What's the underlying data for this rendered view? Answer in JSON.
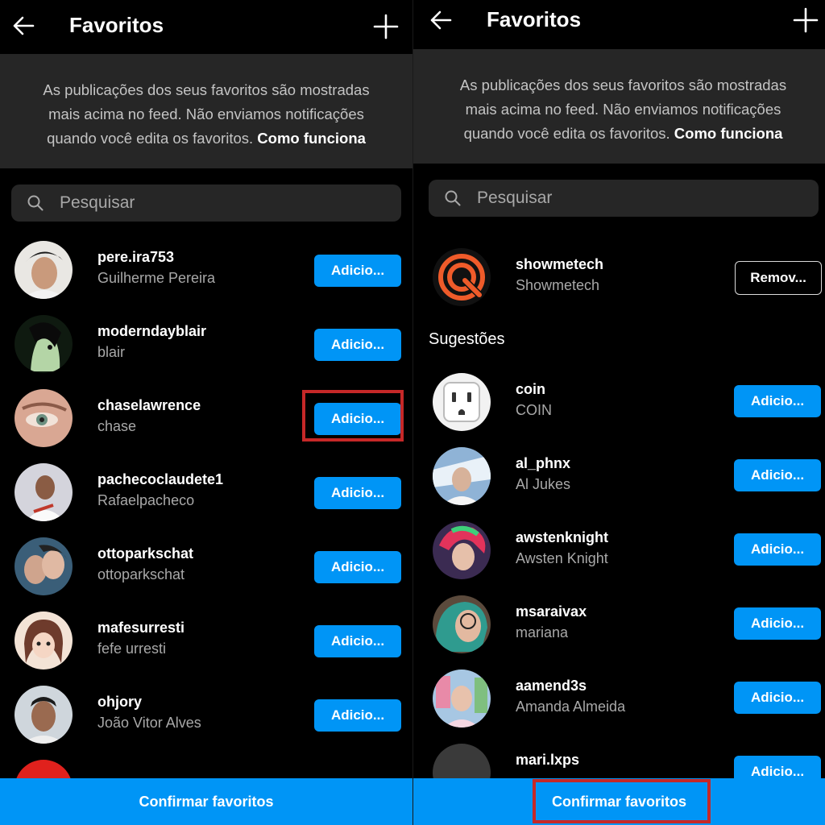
{
  "accent_color": "#0095f6",
  "highlight_color": "#c62828",
  "left": {
    "title": "Favoritos",
    "info_text": "As publicações dos seus favoritos são mostradas mais acima no feed. Não enviamos notificações quando você edita os favoritos.",
    "info_link": "Como funciona",
    "search_placeholder": "Pesquisar",
    "rows": [
      {
        "username": "pere.ira753",
        "name": "Guilherme Pereira",
        "button": "Adicio..."
      },
      {
        "username": "moderndayblair",
        "name": "blair",
        "button": "Adicio..."
      },
      {
        "username": "chaselawrence",
        "name": "chase",
        "button": "Adicio..."
      },
      {
        "username": "pachecoclaudete1",
        "name": "Rafaelpacheco",
        "button": "Adicio..."
      },
      {
        "username": "ottoparkschat",
        "name": "ottoparkschat",
        "button": "Adicio..."
      },
      {
        "username": "mafesurresti",
        "name": "fefe urresti",
        "button": "Adicio..."
      },
      {
        "username": "ohjory",
        "name": "João Vitor Alves",
        "button": "Adicio..."
      }
    ],
    "confirm_label": "Confirmar favoritos"
  },
  "right": {
    "title": "Favoritos",
    "info_text": "As publicações dos seus favoritos são mostradas mais acima no feed. Não enviamos notificações quando você edita os favoritos.",
    "info_link": "Como funciona",
    "search_placeholder": "Pesquisar",
    "favorite": {
      "username": "showmetech",
      "name": "Showmetech",
      "button": "Remov..."
    },
    "suggestions_label": "Sugestões",
    "rows": [
      {
        "username": "coin",
        "name": "COIN",
        "button": "Adicio..."
      },
      {
        "username": "al_phnx",
        "name": "Al Jukes",
        "button": "Adicio..."
      },
      {
        "username": "awstenknight",
        "name": "Awsten Knight",
        "button": "Adicio..."
      },
      {
        "username": "msaraivax",
        "name": "mariana",
        "button": "Adicio..."
      },
      {
        "username": "aamend3s",
        "name": "Amanda Almeida",
        "button": "Adicio..."
      },
      {
        "username": "mari.lxps",
        "name": "",
        "button": "Adicio..."
      }
    ],
    "confirm_label": "Confirmar favoritos"
  }
}
